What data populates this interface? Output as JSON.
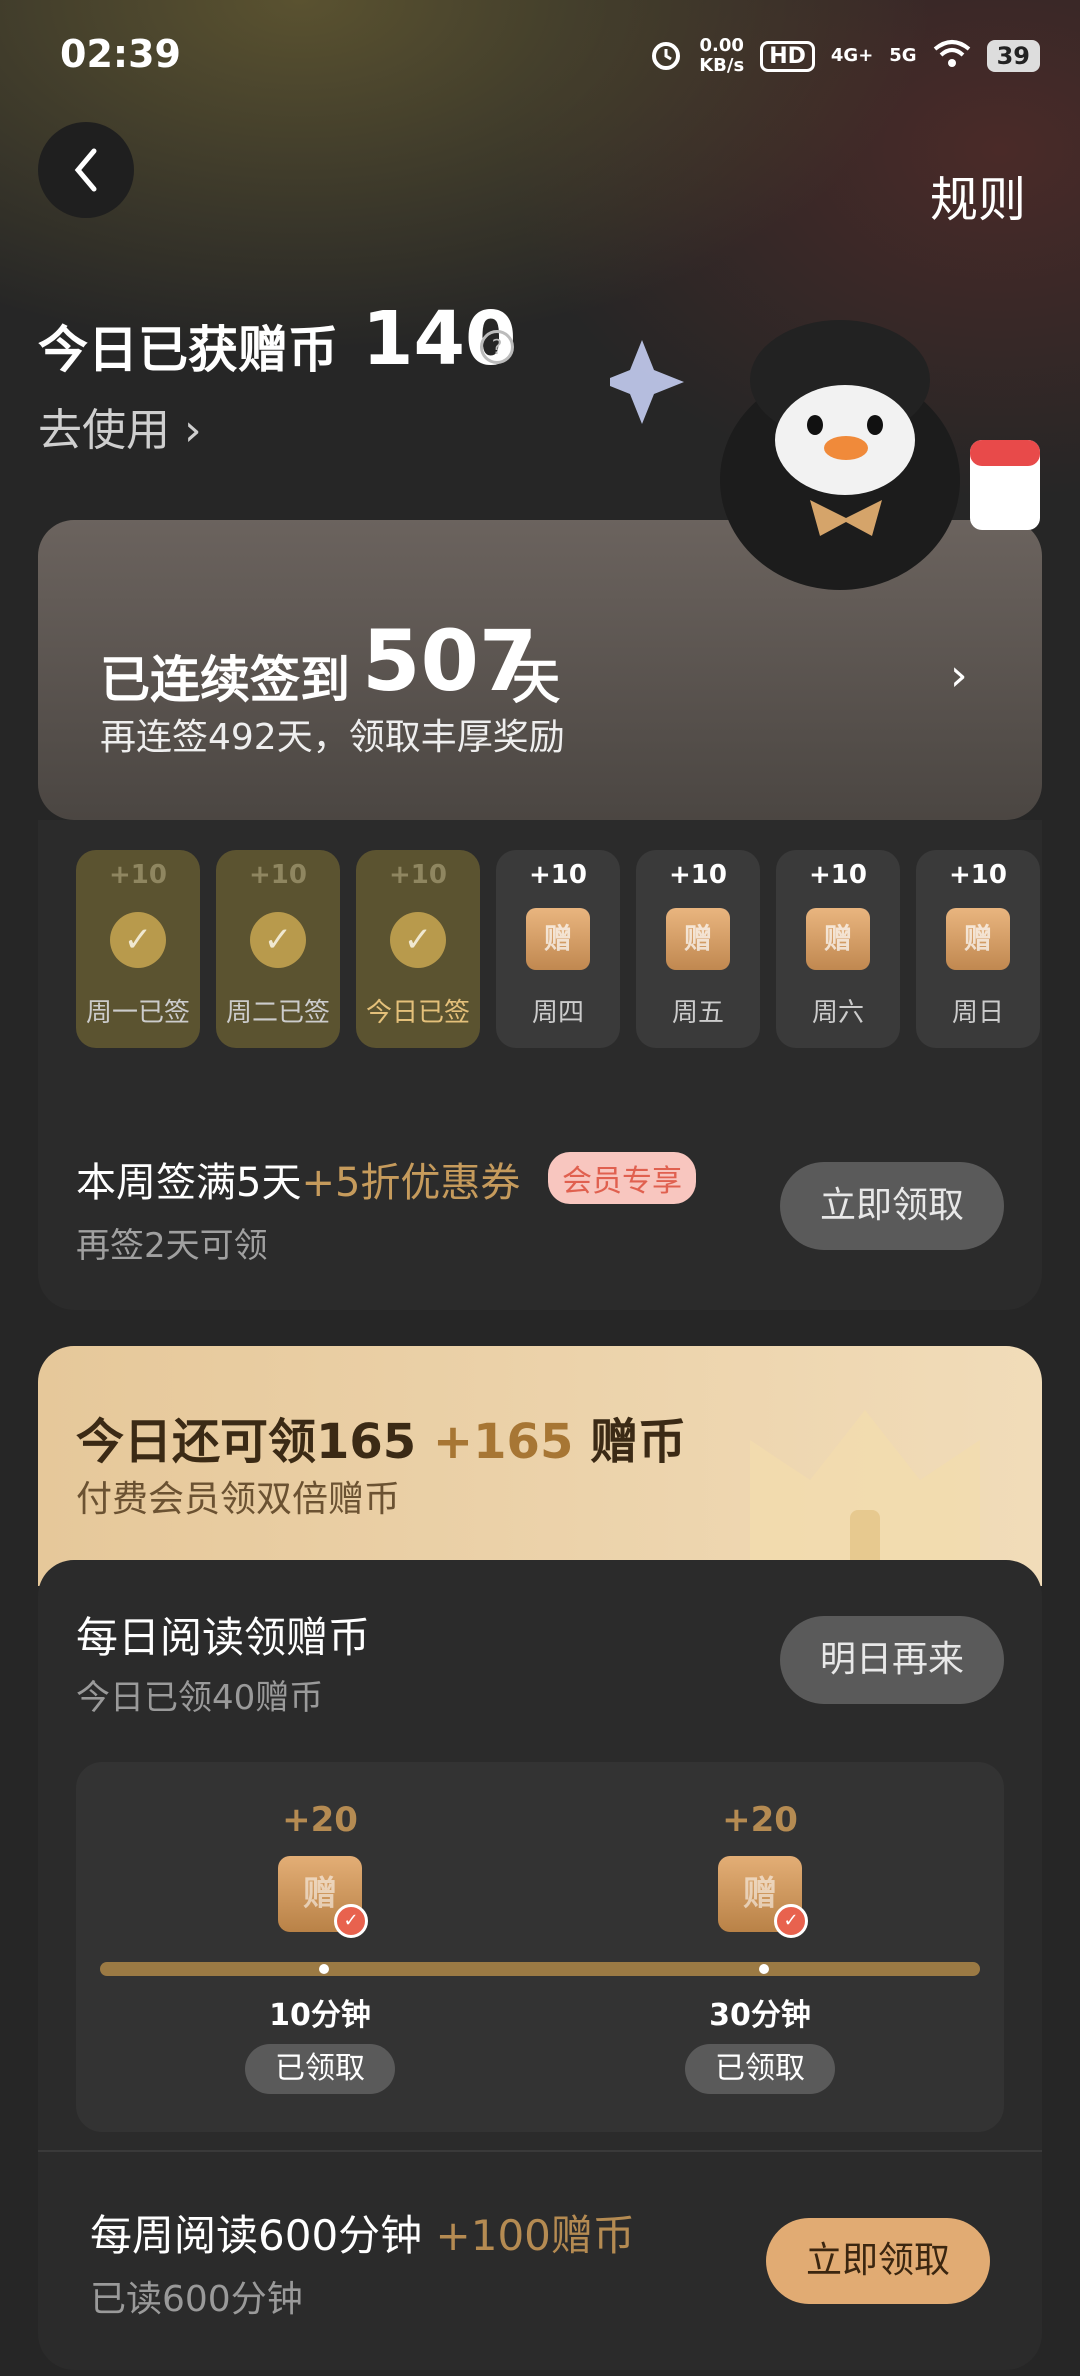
{
  "status_bar": {
    "time": "02:39",
    "net_speed": "0.00",
    "net_unit": "KB/s",
    "hd": "HD",
    "sim_label": "4G+",
    "sim2_label": "5G",
    "battery": "39"
  },
  "header": {
    "rules": "规则"
  },
  "coins": {
    "label": "今日已获赠币",
    "value": "140",
    "help": "?",
    "use_link": "去使用 ›"
  },
  "streak": {
    "label": "已连续签到",
    "days": "507",
    "unit": "天",
    "subtitle": "再连签492天，领取丰厚奖励",
    "chevron": "›"
  },
  "week": {
    "days": [
      {
        "plus": "+10",
        "label": "周一已签",
        "done": true
      },
      {
        "plus": "+10",
        "label": "周二已签",
        "done": true
      },
      {
        "plus": "+10",
        "label": "今日已签",
        "done": true
      },
      {
        "plus": "+10",
        "label": "周四",
        "done": false
      },
      {
        "plus": "+10",
        "label": "周五",
        "done": false
      },
      {
        "plus": "+10",
        "label": "周六",
        "done": false
      },
      {
        "plus": "+10",
        "label": "周日",
        "done": false
      }
    ],
    "ticket_glyph": "赠",
    "check_glyph": "✓",
    "goal_title": "本周签满5天",
    "goal_reward": "+5折优惠券",
    "member_badge": "会员专享",
    "goal_sub": "再签2天可领",
    "claim_button": "立即领取"
  },
  "member_promo": {
    "title": "今日还可领165",
    "plus": "+165",
    "unit": "赠币",
    "subtitle": "付费会员领双倍赠币"
  },
  "daily_reading": {
    "title": "每日阅读领赠币",
    "subtitle": "今日已领40赠币",
    "button": "明日再来",
    "milestones": [
      {
        "plus": "+20",
        "time": "10分钟",
        "status": "已领取"
      },
      {
        "plus": "+20",
        "time": "30分钟",
        "status": "已领取"
      }
    ]
  },
  "weekly_reading": {
    "title": "每周阅读600分钟",
    "reward": "+100赠币",
    "subtitle": "已读600分钟",
    "button": "立即领取"
  },
  "colors": {
    "gold": "#c69b5c",
    "claim_orange": "#e1ab73",
    "member_bg": "#e6c89a",
    "badge_pink": "#f8c6bf"
  }
}
